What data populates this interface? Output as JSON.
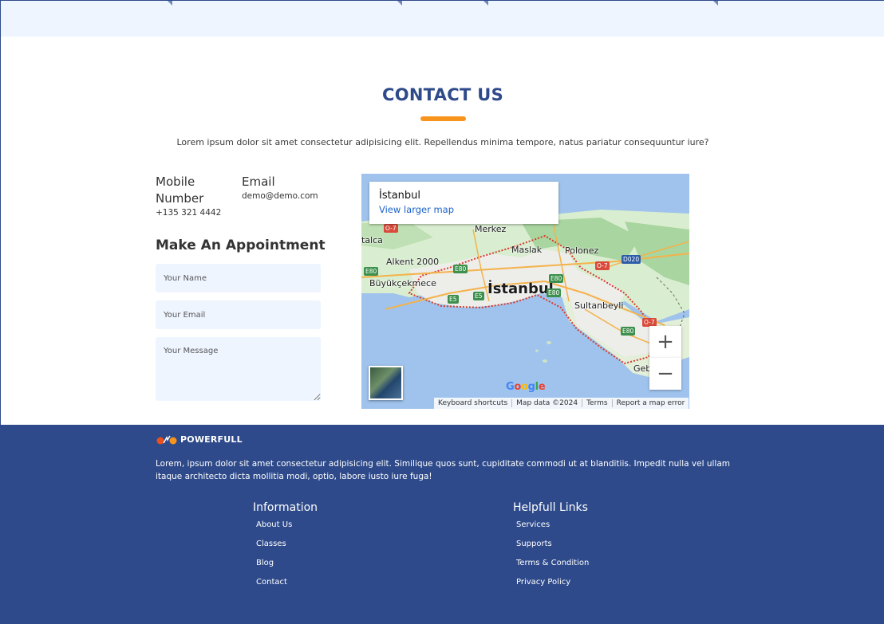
{
  "contact": {
    "title": "CONTACT US",
    "intro": "Lorem ipsum dolor sit amet consectetur adipisicing elit. Repellendus minima tempore, natus pariatur consequuntur iure?",
    "mobile_label": "Mobile Number",
    "mobile_value": "+135 321 4442",
    "email_label": "Email",
    "email_value": "demo@demo.com"
  },
  "appointment": {
    "title": "Make An Appointment",
    "name_placeholder": "Your Name",
    "email_placeholder": "Your Email",
    "message_placeholder": "Your Message"
  },
  "map": {
    "place_name": "İstanbul",
    "larger_map_link": "View larger map",
    "labels": {
      "city": "İstanbul",
      "merkez": "Merkez",
      "maslak": "Maslak",
      "polonez": "Polonez",
      "alkent": "Alkent 2000",
      "buyukcekmece": "Büyükçekmece",
      "sultanbeyli": "Sultanbeyli",
      "gebze": "Geb",
      "talca": "talca"
    },
    "roads": {
      "o7_a": "O-7",
      "o7_b": "O-7",
      "o7_c": "O-7",
      "e80_a": "E80",
      "e80_b": "E80",
      "e80_c": "E80",
      "e80_d": "E80",
      "e80_e": "E80",
      "e5_a": "E5",
      "e5_b": "E5",
      "d020": "D020"
    },
    "zoom_in": "+",
    "zoom_out": "−",
    "google": "Google",
    "attribution": {
      "shortcuts": "Keyboard shortcuts",
      "data": "Map data ©2024",
      "terms": "Terms",
      "report": "Report a map error"
    }
  },
  "footer": {
    "brand": "POWERFULL",
    "description": "Lorem, ipsum dolor sit amet consectetur adipisicing elit. Similique quos sunt, cupiditate commodi ut at blanditiis. Impedit nulla vel ullam itaque architecto dicta mollitia modi, optio, labore iusto iure fuga!",
    "information": {
      "title": "Information",
      "links": [
        "About Us",
        "Classes",
        "Blog",
        "Contact"
      ]
    },
    "helpful": {
      "title": "Helpfull Links",
      "links": [
        "Services",
        "Supports",
        "Terms & Condition",
        "Privacy Policy"
      ]
    }
  },
  "colors": {
    "primary": "#2e4a8a",
    "accent": "#f7941d",
    "field_bg": "#eff5ff"
  }
}
